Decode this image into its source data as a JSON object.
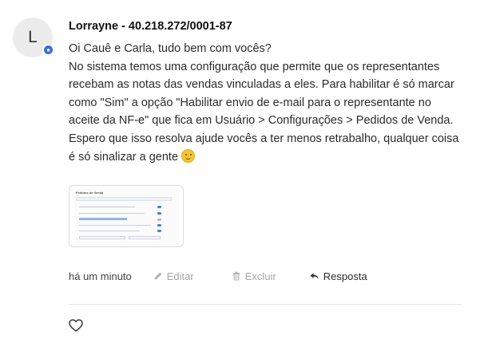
{
  "comment": {
    "avatar_initial": "L",
    "author": "Lorrayne - 40.218.272/0001-87",
    "paragraphs": [
      "Oi Cauê e Carla, tudo bem com vocês?",
      "No sistema temos uma configuração que permite que os representantes recebam as notas das vendas vinculadas a eles. Para habilitar é só marcar como \"Sim\" a opção \"Habilitar envio de e-mail para o representante no aceite da NF-e\" que fica em Usuário > Configurações > Pedidos de Venda.",
      "Espero que isso resolva ajude vocês a ter menos retrabalho, qualquer coisa é só sinalizar a gente"
    ],
    "emoji": "smiling-face",
    "attachment": {
      "title": "Pedidos de Venda"
    }
  },
  "actions": {
    "time": "há um minuto",
    "edit_label": "Editar",
    "delete_label": "Excluir",
    "reply_label": "Resposta"
  },
  "icons": {
    "badge": "user-badge-icon",
    "edit": "pencil-icon",
    "delete": "trash-icon",
    "reply": "reply-arrow-icon",
    "like": "heart-icon"
  },
  "colors": {
    "badge": "#3b6fd8",
    "disabled": "#a6a6a6",
    "avatar_bg": "#ececec"
  }
}
